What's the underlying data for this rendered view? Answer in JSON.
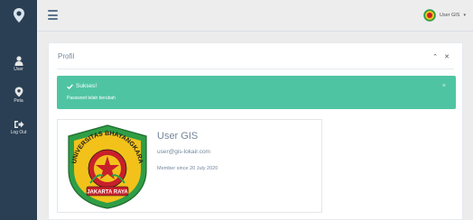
{
  "sidebar": {
    "items": [
      {
        "label": "User",
        "icon": "user-icon"
      },
      {
        "label": "Peta",
        "icon": "map-marker-icon"
      },
      {
        "label": "Log Out",
        "icon": "sign-out-icon"
      }
    ]
  },
  "topbar": {
    "user_name": "User GIS",
    "caret": "▾"
  },
  "panel": {
    "title": "Profil",
    "tool_collapse": "⌃",
    "tool_close": "✕"
  },
  "alert": {
    "title": "Sukses!",
    "message": "Password telah berubah",
    "close": "×"
  },
  "profile": {
    "name": "User GIS",
    "email": "user@gis-lokair.com",
    "member_since": "Member since 20 July 2020",
    "emblem_top_text": "UNIVERSITAS BHAYANGKARA",
    "emblem_bottom_text": "JAKARTA RAYA"
  },
  "colors": {
    "sidebar": "#2a3f54",
    "alert": "#4fc4a3",
    "emblem_ring": "#2f9e46",
    "emblem_red": "#c8202a",
    "emblem_yellow": "#f2c21b"
  }
}
